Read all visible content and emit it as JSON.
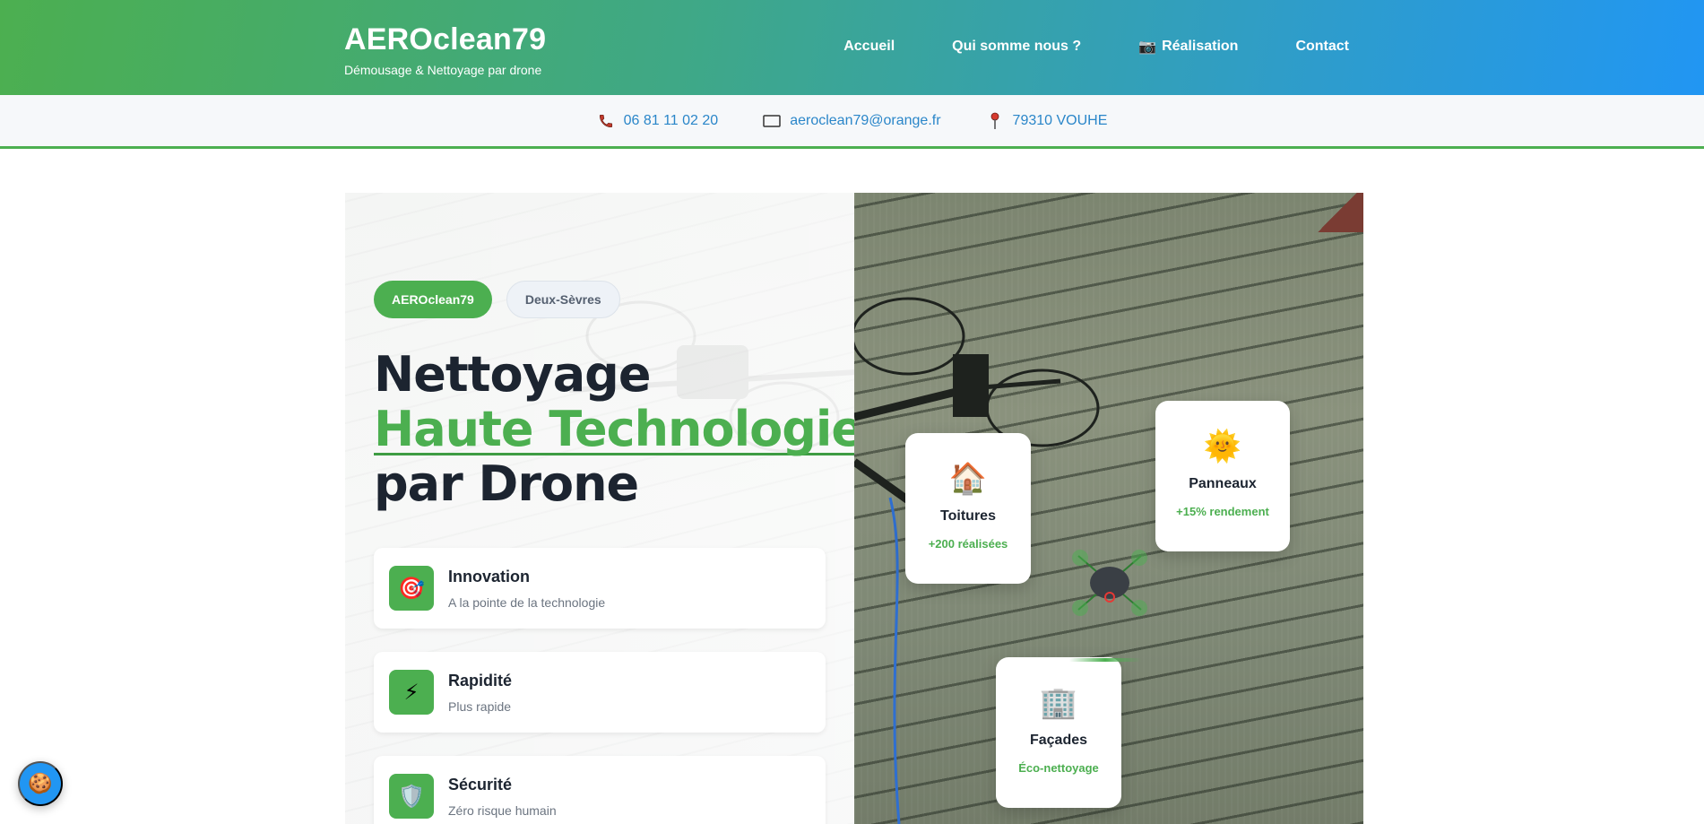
{
  "header": {
    "brand_title": "AEROclean79",
    "brand_subtitle": "Démousage & Nettoyage par drone",
    "nav": [
      {
        "label": "Accueil",
        "icon": ""
      },
      {
        "label": "Qui somme nous ?",
        "icon": ""
      },
      {
        "label": "Réalisation",
        "icon": "📷"
      },
      {
        "label": "Contact",
        "icon": ""
      }
    ]
  },
  "contact": {
    "phone": "06 81 11 02 20",
    "email": "aeroclean79@orange.fr",
    "location": "79310 VOUHE",
    "phone_icon": "phone-icon",
    "email_icon": "envelope-icon",
    "location_icon": "pin-icon"
  },
  "hero": {
    "tag_primary": "AEROclean79",
    "tag_secondary": "Deux-Sèvres",
    "headline_line1": "Nettoyage",
    "headline_line2": "Haute Technologie",
    "headline_line3": "par Drone",
    "features": [
      {
        "title": "Innovation",
        "desc": "A la pointe de la technologie",
        "icon": "🎯"
      },
      {
        "title": "Rapidité",
        "desc": "Plus rapide",
        "icon": "⚡"
      },
      {
        "title": "Sécurité",
        "desc": "Zéro risque humain",
        "icon": "🛡️"
      }
    ],
    "cards": [
      {
        "title": "Toitures",
        "sub": "+200 réalisées",
        "icon": "🏠"
      },
      {
        "title": "Panneaux",
        "sub": "+15% rendement",
        "icon": "🌞"
      },
      {
        "title": "Façades",
        "sub": "Éco-nettoyage",
        "icon": "🏢"
      }
    ]
  },
  "cookie": {
    "icon": "🍪"
  },
  "colors": {
    "brand_green": "#4caf50",
    "brand_blue": "#2196f3",
    "link_blue": "#2a86c9",
    "dark_text": "#1c2430"
  }
}
